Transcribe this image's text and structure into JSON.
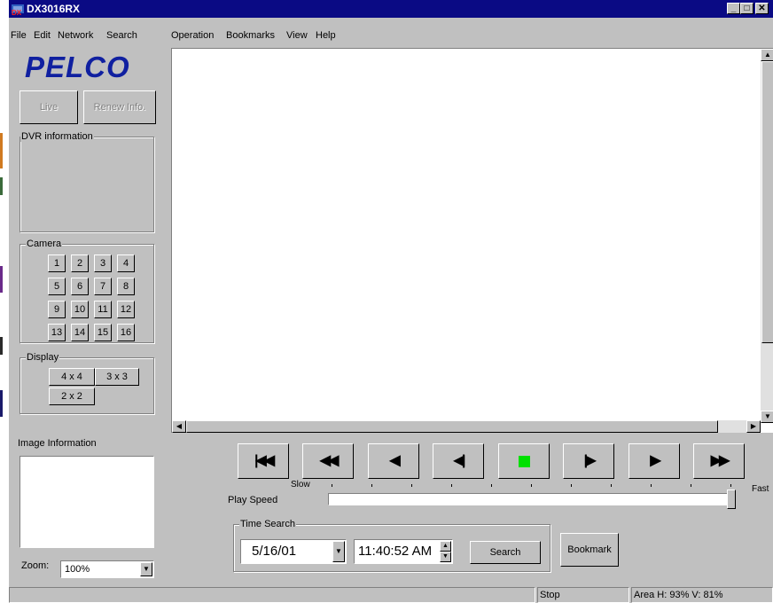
{
  "window": {
    "title": "DX3016RX"
  },
  "title_buttons": {
    "minimize": "_",
    "maximize": "□",
    "close": "✕"
  },
  "menu": [
    "File",
    "Edit",
    "Network",
    "Search",
    "Operation",
    "Bookmarks",
    "View",
    "Help"
  ],
  "logo": "PELCO",
  "top_buttons": {
    "live": "Live",
    "renew": "Renew Info."
  },
  "dvr_info": {
    "label": "DVR information"
  },
  "camera": {
    "label": "Camera",
    "buttons": [
      "1",
      "2",
      "3",
      "4",
      "5",
      "6",
      "7",
      "8",
      "9",
      "10",
      "11",
      "12",
      "13",
      "14",
      "15",
      "16"
    ]
  },
  "display": {
    "label": "Display",
    "buttons": [
      "4 x 4",
      "3 x 3",
      "2 x 2"
    ]
  },
  "image_info": {
    "label": "Image Information"
  },
  "zoom": {
    "label": "Zoom:",
    "value": "100%"
  },
  "controls": {
    "buttons": [
      "|◀◀",
      "◀◀",
      "◀",
      "◀|",
      "stop",
      "|▶",
      "▶",
      "▶▶"
    ],
    "stop_color": "#00e000"
  },
  "speed": {
    "label": "Play Speed",
    "slow": "Slow",
    "fast": "Fast",
    "level": 1.0
  },
  "time_search": {
    "label": "Time Search",
    "date": "5/16/01",
    "time": "11:40:52 AM",
    "search_button": "Search"
  },
  "bookmark_button": "Bookmark",
  "status": {
    "state": "Stop",
    "area": "Area H: 93% V: 81%"
  }
}
